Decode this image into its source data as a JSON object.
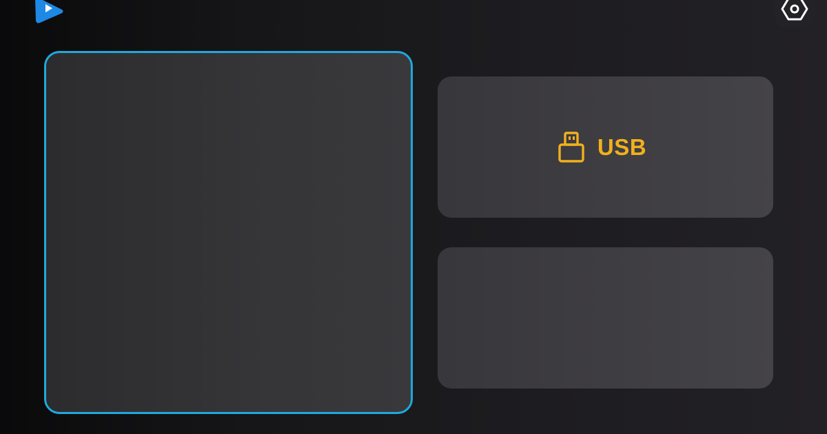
{
  "header": {
    "logo_icon": "play-triangle-icon",
    "settings_icon": "gear-icon"
  },
  "tiles": {
    "main": {},
    "usb": {
      "label": "USB",
      "icon": "usb-drive-icon"
    },
    "bottom": {}
  },
  "colors": {
    "accent": "#1fa9dc",
    "usb_label": "#f2b01d",
    "logo": "#1e88e5",
    "background": "#161618",
    "tile": "#3e3d41"
  }
}
